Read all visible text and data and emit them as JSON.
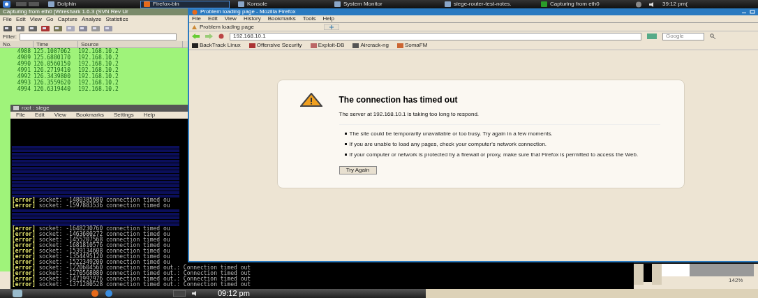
{
  "taskbar": {
    "tasks": [
      {
        "label": "Dolphin",
        "selected": false
      },
      {
        "label": "Firefox-bin",
        "selected": true
      },
      {
        "label": "Konsole",
        "selected": false
      },
      {
        "label": "System Monitor",
        "selected": false
      },
      {
        "label": "siege-router-test-notes.",
        "selected": false
      },
      {
        "label": "Capturing from eth0",
        "selected": false
      }
    ],
    "clock": "39:12 pm("
  },
  "wireshark": {
    "title": "Capturing from eth0   [Wireshark 1.6.3  (SVN Rev Ur",
    "menu": [
      "File",
      "Edit",
      "View",
      "Go",
      "Capture",
      "Analyze",
      "Statistics"
    ],
    "filter_label": "Filter:",
    "columns": [
      "No.",
      "Time",
      "Source"
    ],
    "rows": [
      [
        "4988",
        "125.1087062",
        "192.168.10.2"
      ],
      [
        "4989",
        "125.6880170",
        "192.168.10.2"
      ],
      [
        "4990",
        "126.0560150",
        "192.168.10.2"
      ],
      [
        "4991",
        "126.2719410",
        "192.168.10.2"
      ],
      [
        "4992",
        "126.3439800",
        "192.168.10.2"
      ],
      [
        "4993",
        "126.3559620",
        "192.168.10.2"
      ],
      [
        "4994",
        "126.6319440",
        "192.168.10.2"
      ]
    ]
  },
  "konsole": {
    "title": "root : siege",
    "menu": [
      "File",
      "Edit",
      "View",
      "Bookmarks",
      "Settings",
      "Help"
    ],
    "lines": [
      {
        "kind": "blurred"
      },
      {
        "kind": "blurred"
      },
      {
        "kind": "blurred"
      },
      {
        "kind": "blurred"
      },
      {
        "kind": "blurred"
      },
      {
        "kind": "blurred"
      },
      {
        "kind": "blurred"
      },
      {
        "kind": "blurred"
      },
      {
        "kind": "blurred"
      },
      {
        "kind": "blurred"
      },
      {
        "kind": "blurred"
      },
      {
        "kind": "blurred"
      },
      {
        "kind": "blurred"
      },
      {
        "kind": "blurred"
      },
      {
        "kind": "blurred"
      },
      {
        "kind": "error",
        "tag": "[error]",
        "message": "socket: -1480385680 connection timed ou"
      },
      {
        "kind": "error",
        "tag": "[error]",
        "message": "socket: -1597883536 connection timed ou"
      },
      {
        "kind": "blurred"
      },
      {
        "kind": "blurred"
      },
      {
        "kind": "blurred"
      },
      {
        "kind": "blurred"
      },
      {
        "kind": "blurred"
      },
      {
        "kind": "error",
        "tag": "[error]",
        "message": "socket: -1648230760 connection timed ou"
      },
      {
        "kind": "error",
        "tag": "[error]",
        "message": "socket: -1463600272 connection timed ou"
      },
      {
        "kind": "error",
        "tag": "[error]",
        "message": "socket: -1455207568 connection timed ou"
      },
      {
        "kind": "error",
        "tag": "[error]",
        "message": "socket: -1681810576 connection timed ou"
      },
      {
        "kind": "error",
        "tag": "[error]",
        "message": "socket: -1539134608 connection timed ou"
      },
      {
        "kind": "error",
        "tag": "[error]",
        "message": "socket: -1354495120 connection timed ou"
      },
      {
        "kind": "error",
        "tag": "[error]",
        "message": "socket: -1522349200 connection timed ou"
      },
      {
        "kind": "error",
        "tag": "[error]",
        "message": "socket: -1220604560 connection timed out.: Connection timed out"
      },
      {
        "kind": "error",
        "tag": "[error]",
        "message": "socket: -1270568080 connection timed out.: Connection timed out"
      },
      {
        "kind": "error",
        "tag": "[error]",
        "message": "socket: -1471992976 connection timed out.: Connection timed out"
      },
      {
        "kind": "error",
        "tag": "[error]",
        "message": "socket: -1371280528 connection timed out.: Connection timed out"
      }
    ]
  },
  "firefox": {
    "title": "Problem loading page - Mozilla Firefox",
    "menu": [
      "File",
      "Edit",
      "View",
      "History",
      "Bookmarks",
      "Tools",
      "Help"
    ],
    "tab": "Problem loading page",
    "url": "192.168.10.1",
    "search_placeholder": "Google",
    "bookmarks": [
      "BackTrack Linux",
      "Offensive Security",
      "Exploit-DB",
      "Aircrack-ng",
      "SomaFM"
    ],
    "error": {
      "title": "The connection has timed out",
      "summary": "The server at 192.168.10.1 is taking too long to respond.",
      "bullets": [
        "The site could be temporarily unavailable or too busy. Try again in a few moments.",
        "If you are unable to load any pages, check your computer's network connection.",
        "If your computer or network is protected by a firewall or proxy, make sure that Firefox is permitted to access the Web."
      ],
      "button": "Try Again"
    }
  },
  "zoom": "142%",
  "panel": {
    "clock": "09:12 pm"
  }
}
